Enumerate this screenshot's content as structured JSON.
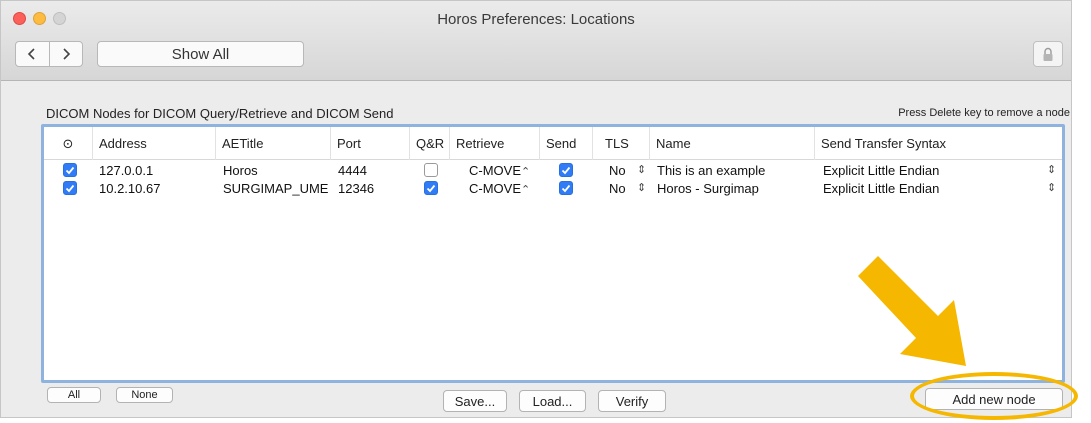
{
  "window": {
    "title": "Horos Preferences: Locations",
    "show_all_label": "Show All",
    "back_glyph": "‹",
    "forward_glyph": "›",
    "lock_icon": "lock-icon"
  },
  "section": {
    "title": "DICOM Nodes for DICOM Query/Retrieve and DICOM Send",
    "hint": "Press Delete key to remove a node"
  },
  "table": {
    "columns": {
      "enabled": "⊙",
      "address": "Address",
      "aetitle": "AETitle",
      "port": "Port",
      "qr": "Q&R",
      "retrieve": "Retrieve",
      "send": "Send",
      "tls": "TLS",
      "name": "Name",
      "syntax": "Send Transfer Syntax"
    },
    "rows": [
      {
        "enabled": true,
        "address": "127.0.0.1",
        "aetitle": "Horos",
        "port": "4444",
        "qr": false,
        "retrieve": "C-MOVE",
        "send": true,
        "tls": "No",
        "name": "This is an example",
        "syntax": "Explicit Little Endian"
      },
      {
        "enabled": true,
        "address": "10.2.10.67",
        "aetitle": "SURGIMAP_UME",
        "port": "12346",
        "qr": true,
        "retrieve": "C-MOVE",
        "send": true,
        "tls": "No",
        "name": "Horos - Surgimap",
        "syntax": "Explicit Little Endian"
      }
    ],
    "stepper_glyph": "⌃⌄"
  },
  "buttons": {
    "all": "All",
    "none": "None",
    "save": "Save...",
    "load": "Load...",
    "verify": "Verify",
    "add_node": "Add new node"
  },
  "colors": {
    "checkbox_on": "#2f7cf6",
    "annotation": "#f5b700",
    "table_focus_border": "#8fb3df"
  }
}
